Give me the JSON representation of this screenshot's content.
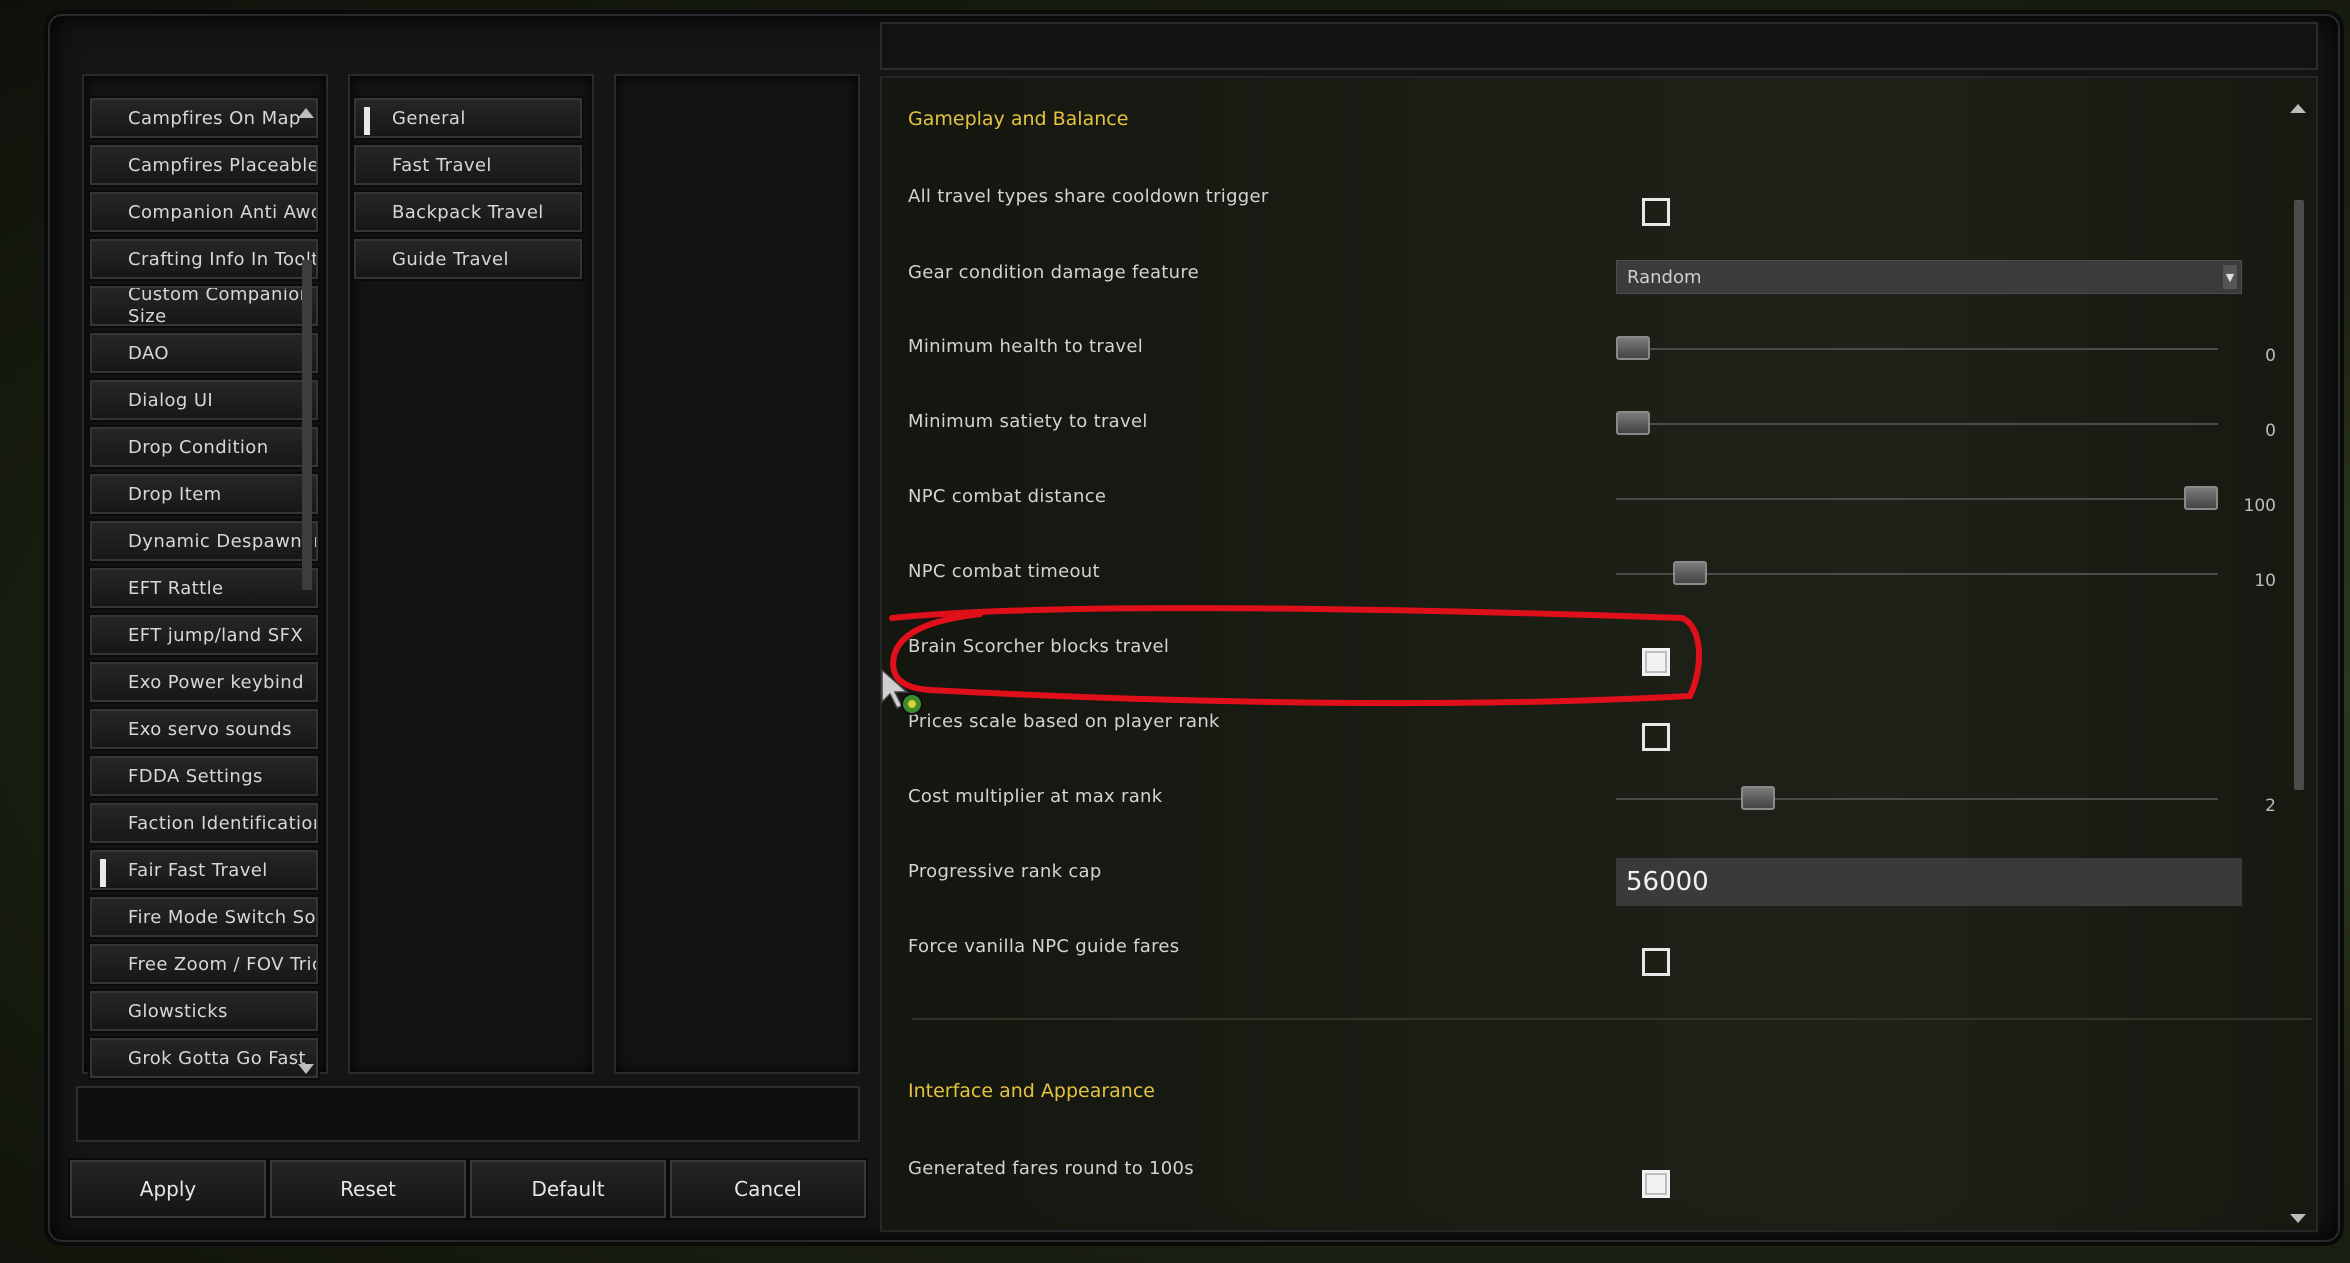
{
  "mod_list": {
    "items": [
      {
        "label": "Campfires On Map"
      },
      {
        "label": "Campfires Placeable"
      },
      {
        "label": "Companion Anti Awol"
      },
      {
        "label": "Crafting Info In Tooltips"
      },
      {
        "label": "Custom Companion Squad",
        "label2": "Size"
      },
      {
        "label": "DAO"
      },
      {
        "label": "Dialog UI"
      },
      {
        "label": "Drop Condition"
      },
      {
        "label": "Drop Item"
      },
      {
        "label": "Dynamic Despawner"
      },
      {
        "label": "EFT Rattle"
      },
      {
        "label": "EFT jump/land SFX"
      },
      {
        "label": "Exo Power keybind"
      },
      {
        "label": "Exo servo sounds"
      },
      {
        "label": "FDDA Settings"
      },
      {
        "label": "Faction Identification"
      },
      {
        "label": "Fair Fast Travel",
        "selected": true
      },
      {
        "label": "Fire Mode Switch Sounds"
      },
      {
        "label": "Free Zoom / FOV Tricks"
      },
      {
        "label": "Glowsticks"
      },
      {
        "label": "Grok Gotta Go Fast"
      }
    ]
  },
  "subcategories": {
    "items": [
      {
        "label": "General",
        "selected": true
      },
      {
        "label": "Fast Travel"
      },
      {
        "label": "Backpack Travel"
      },
      {
        "label": "Guide Travel"
      }
    ]
  },
  "actions": {
    "apply": "Apply",
    "reset": "Reset",
    "default": "Default",
    "cancel": "Cancel"
  },
  "settings": {
    "section1_title": "Gameplay and Balance",
    "section2_title": "Interface and Appearance",
    "share_cooldown": {
      "label": "All travel types share cooldown trigger",
      "checked": false
    },
    "gear_condition": {
      "label": "Gear condition damage feature",
      "value": "Random"
    },
    "min_health": {
      "label": "Minimum health to travel",
      "value": "0",
      "fraction": 0.0
    },
    "min_satiety": {
      "label": "Minimum satiety to travel",
      "value": "0",
      "fraction": 0.0
    },
    "npc_distance": {
      "label": "NPC combat distance",
      "value": "100",
      "fraction": 1.0
    },
    "npc_timeout": {
      "label": "NPC combat timeout",
      "value": "10",
      "fraction": 0.1
    },
    "brain_scorcher": {
      "label": "Brain Scorcher blocks travel",
      "checked": false
    },
    "prices_scale": {
      "label": "Prices scale based on player rank",
      "checked": false
    },
    "cost_multiplier": {
      "label": "Cost multiplier at max rank",
      "value": "2",
      "fraction": 0.22
    },
    "rank_cap": {
      "label": "Progressive rank cap",
      "value": "56000"
    },
    "vanilla_npc": {
      "label": "Force vanilla NPC guide fares",
      "checked": false
    },
    "round_fares": {
      "label": "Generated fares round to 100s",
      "checked": false
    }
  },
  "colors": {
    "section_title": "#e4c341",
    "annotation": "#e0101a"
  }
}
